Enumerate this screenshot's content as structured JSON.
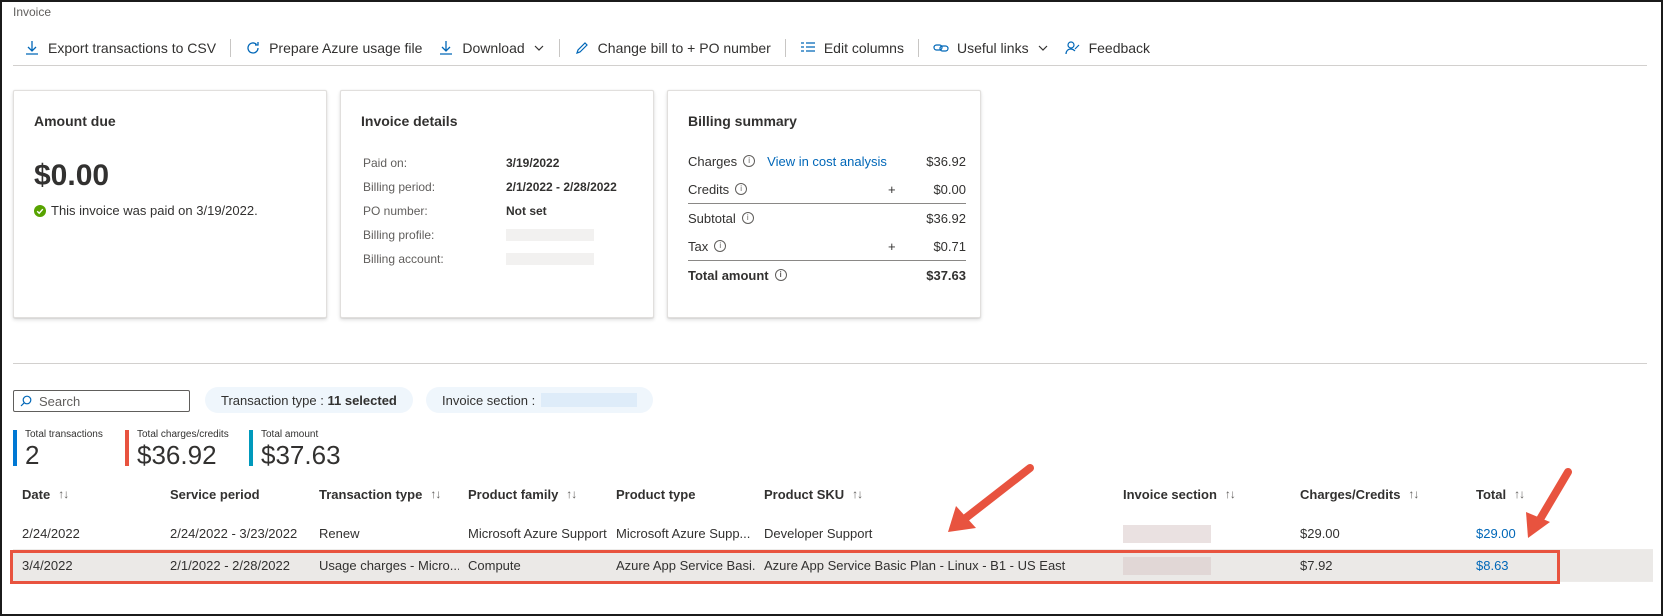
{
  "page": {
    "title": "Invoice"
  },
  "toolbar": {
    "export_csv": "Export transactions to CSV",
    "prepare_usage": "Prepare Azure usage file",
    "download": "Download",
    "change_bill_to": "Change bill to + PO number",
    "edit_columns": "Edit columns",
    "useful_links": "Useful links",
    "feedback": "Feedback"
  },
  "amount_due": {
    "title": "Amount due",
    "amount": "$0.00",
    "status": "This invoice was paid on 3/19/2022."
  },
  "invoice_details": {
    "title": "Invoice details",
    "rows": [
      {
        "label": "Paid on:",
        "value": "3/19/2022"
      },
      {
        "label": "Billing period:",
        "value": "2/1/2022 - 2/28/2022"
      },
      {
        "label": "PO number:",
        "value": "Not set"
      },
      {
        "label": "Billing profile:",
        "value": ""
      },
      {
        "label": "Billing account:",
        "value": ""
      }
    ]
  },
  "billing_summary": {
    "title": "Billing summary",
    "charges_label": "Charges",
    "cost_analysis_link": "View in cost analysis",
    "charges": "$36.92",
    "credits_label": "Credits",
    "credits": "$0.00",
    "subtotal_label": "Subtotal",
    "subtotal": "$36.92",
    "tax_label": "Tax",
    "tax": "$0.71",
    "total_label": "Total amount",
    "total": "$37.63",
    "plus": "+"
  },
  "filters": {
    "search_placeholder": "Search",
    "transaction_type_label": "Transaction type : ",
    "transaction_type_value": "11 selected",
    "invoice_section_label": "Invoice section :"
  },
  "kpis": [
    {
      "label": "Total transactions",
      "value": "2",
      "color": "#0078d4"
    },
    {
      "label": "Total charges/credits",
      "value": "$36.92",
      "color": "#e8533f"
    },
    {
      "label": "Total amount",
      "value": "$37.63",
      "color": "#0099bc"
    }
  ],
  "table": {
    "columns": [
      "Date",
      "Service period",
      "Transaction type",
      "Product family",
      "Product type",
      "Product SKU",
      "Invoice section",
      "Charges/Credits",
      "Total"
    ],
    "rows": [
      [
        "2/24/2022",
        "2/24/2022 - 3/23/2022",
        "Renew",
        "Microsoft Azure Support",
        "Microsoft Azure Supp...",
        "Developer Support",
        "",
        "$29.00",
        "$29.00"
      ],
      [
        "3/4/2022",
        "2/1/2022 - 2/28/2022",
        "Usage charges - Micro...",
        "Compute",
        "Azure App Service Basi...",
        "Azure App Service Basic Plan - Linux - B1 - US East",
        "",
        "$7.92",
        "$8.63"
      ]
    ]
  },
  "colors": {
    "accent": "#0067b8",
    "highlight": "#e8533f",
    "success": "#57a300"
  }
}
